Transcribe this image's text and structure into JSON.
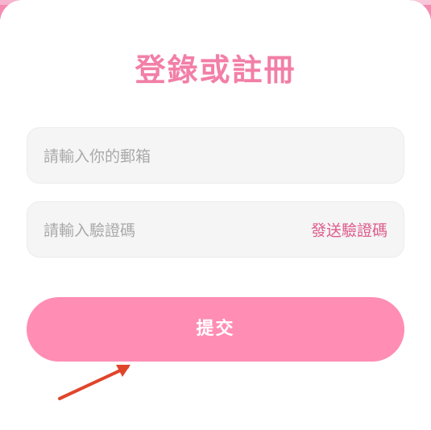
{
  "form": {
    "title": "登錄或註冊",
    "email": {
      "placeholder": "請輸入你的郵箱",
      "value": ""
    },
    "code": {
      "placeholder": "請輸入驗證碼",
      "value": ""
    },
    "send_code_label": "發送驗證碼",
    "submit_label": "提交"
  },
  "colors": {
    "title": "#f27fa7",
    "submit_button": "#ff8db4",
    "send_code": "#dd5b8b",
    "input_background": "#f5f5f5",
    "placeholder": "#a9a9a9",
    "arrow": "#e0452b"
  },
  "icons": {
    "annotation": "arrow-icon"
  }
}
